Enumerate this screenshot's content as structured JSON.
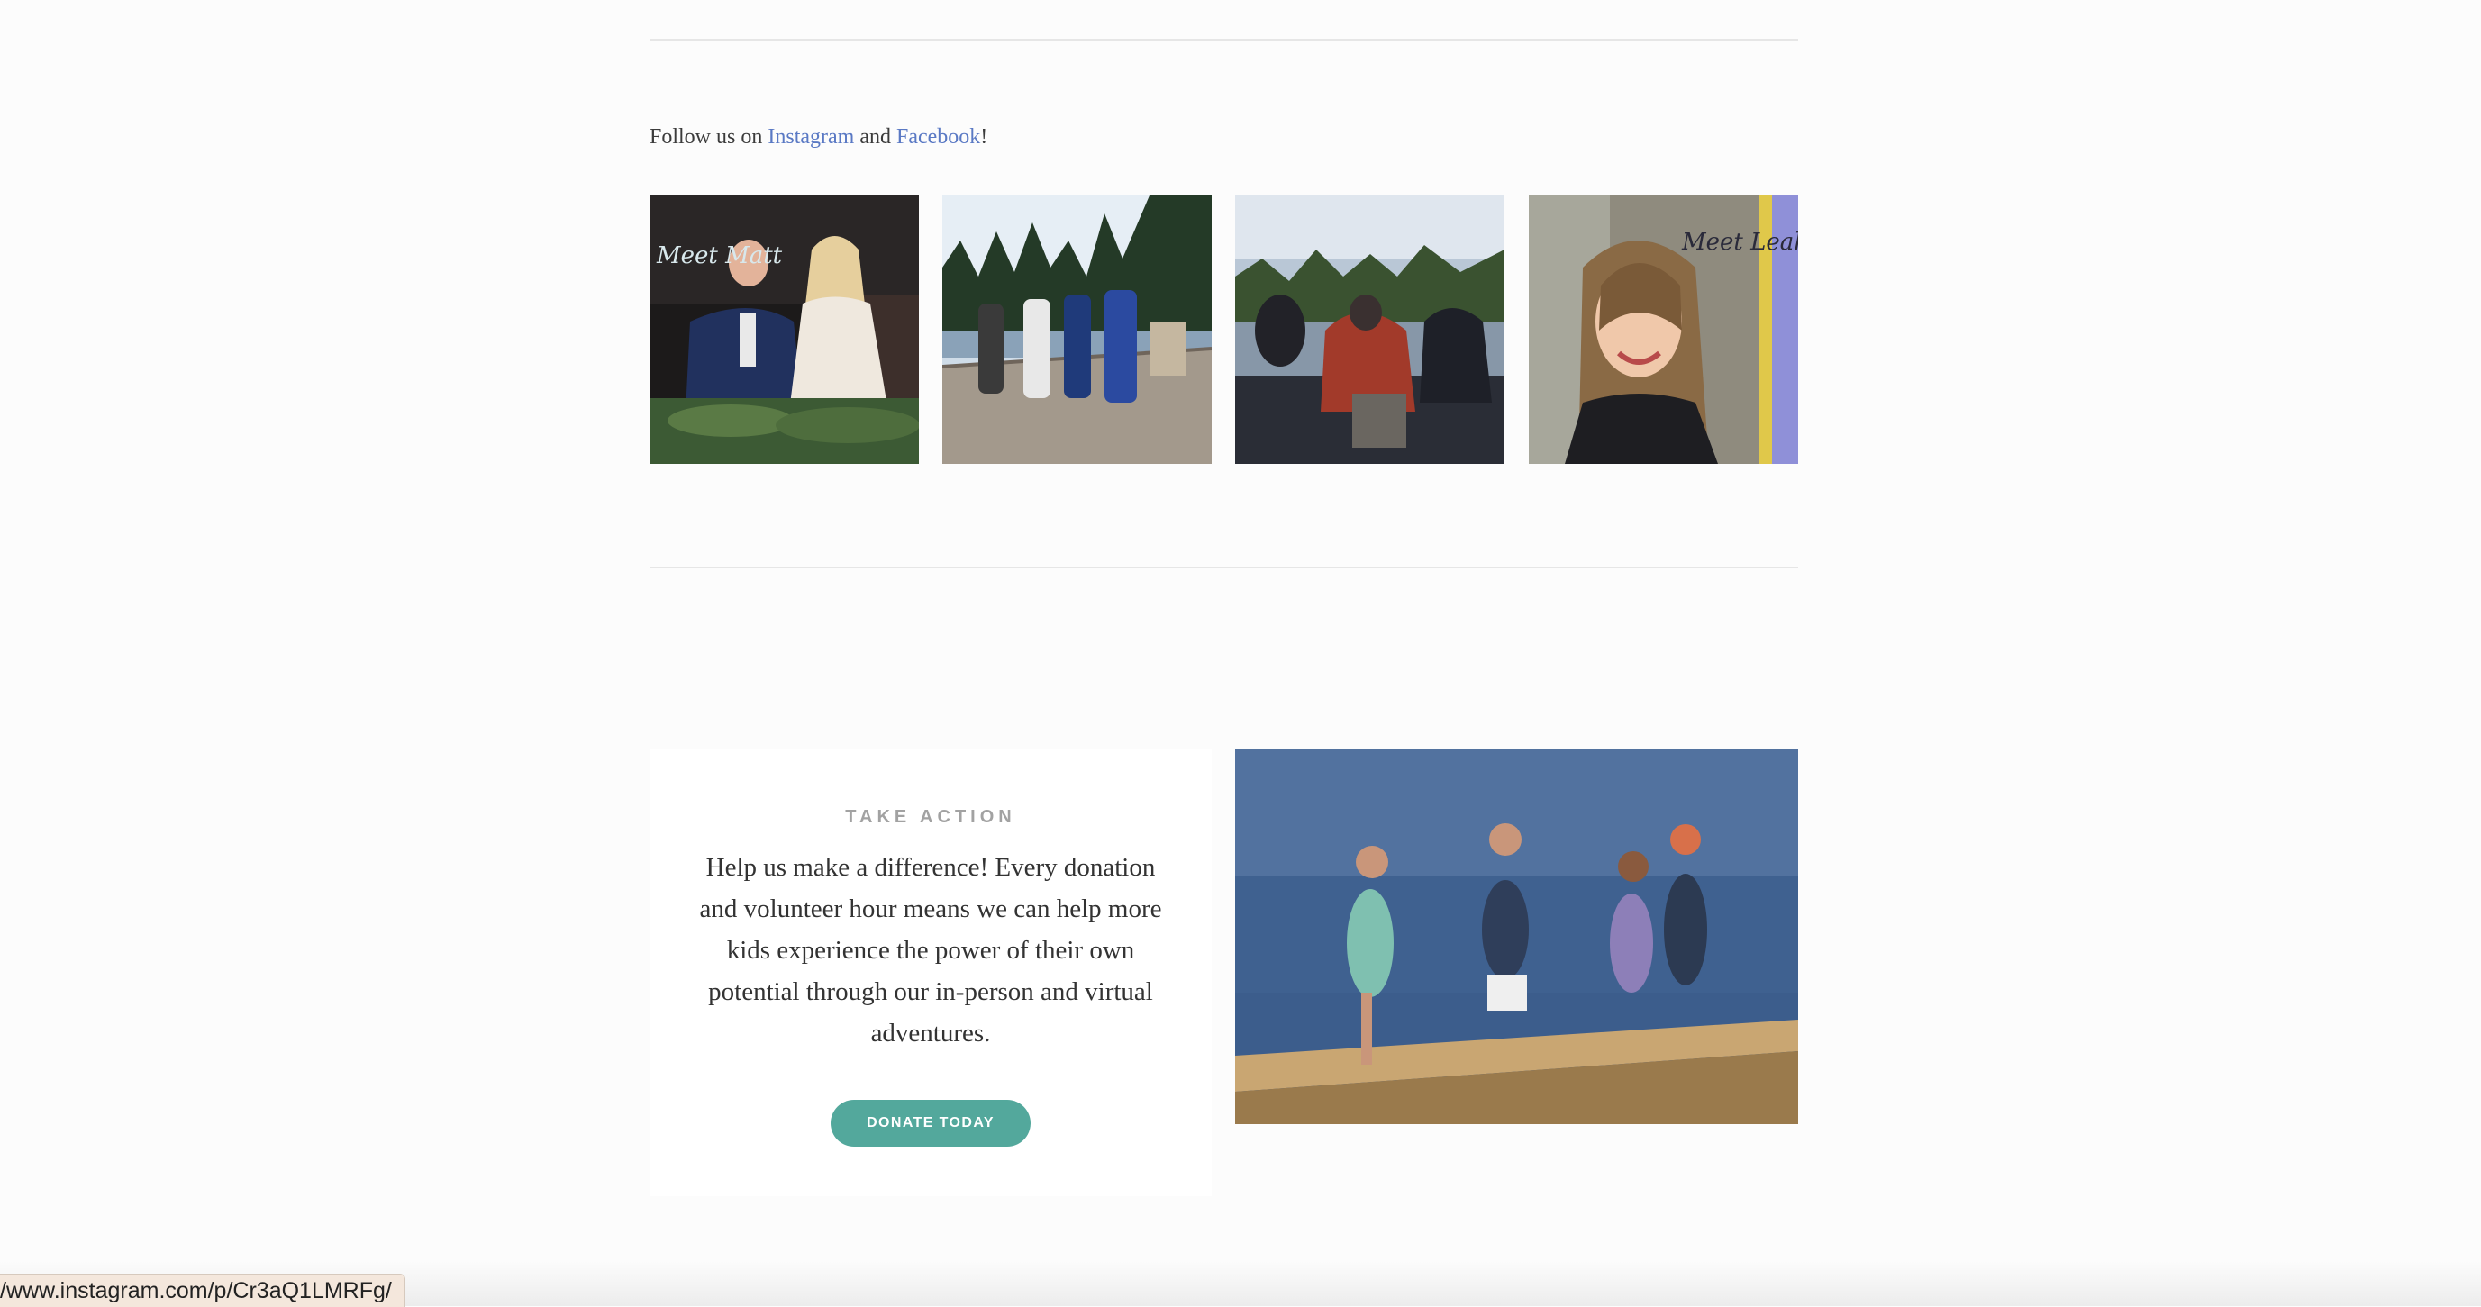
{
  "social": {
    "prefix": "Follow us on ",
    "instagram_label": "Instagram",
    "middle": " and ",
    "facebook_label": "Facebook",
    "suffix": "!"
  },
  "instagram_posts": [
    {
      "alt": "Couple toasting at wedding table",
      "overlay_text": "Meet Matt"
    },
    {
      "alt": "Group of five on a wooden dock by the lake"
    },
    {
      "alt": "Group on a raft on the river"
    },
    {
      "alt": "Smiling girl by a colorful wall",
      "overlay_text": "Meet Leah"
    }
  ],
  "take_action": {
    "eyebrow": "TAKE ACTION",
    "body": "Help us make a difference! Every donation and volunteer hour means we can help more kids experience the power of their own potential through our in-person and virtual adventures.",
    "button_label": "DONATE TODAY",
    "button_color": "#53a89c",
    "photo_alt": "Kids celebrating on floating logs in a lake"
  },
  "status_bar": {
    "url": "/www.instagram.com/p/Cr3aQ1LMRFg/"
  },
  "colors": {
    "link": "#5a79c4",
    "divider": "#e6e6e6",
    "background": "#fcfcfc"
  }
}
